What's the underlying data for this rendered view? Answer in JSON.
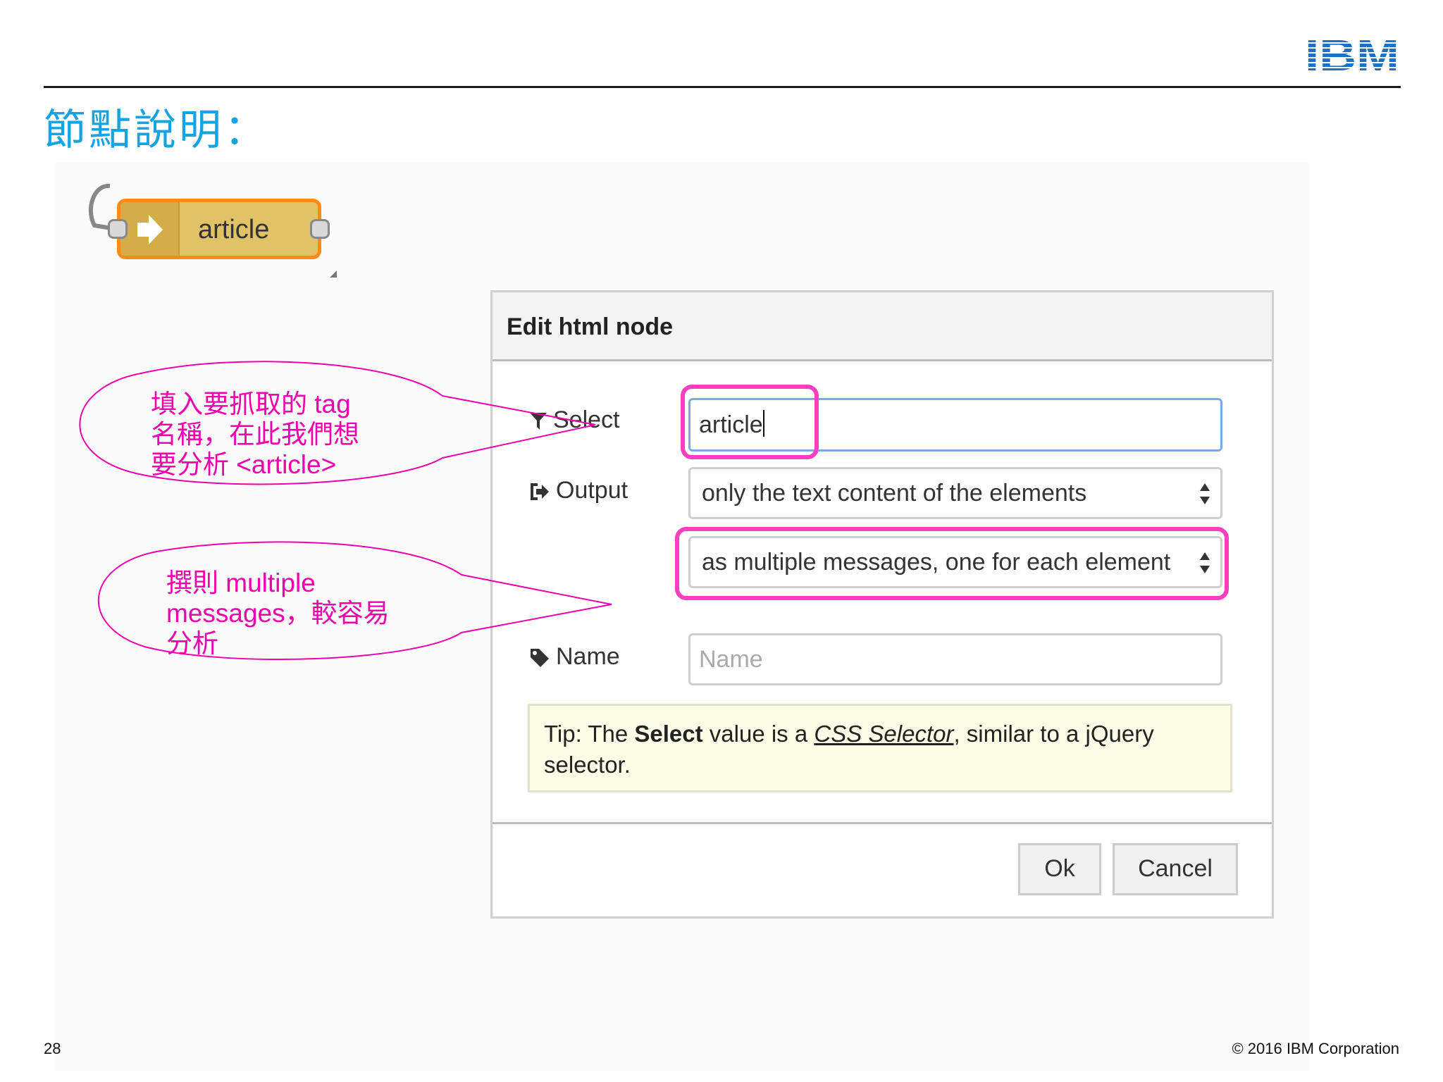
{
  "header": {
    "logo_text": "IBM",
    "title": "節點說明："
  },
  "flow_node": {
    "label": "article"
  },
  "dialog": {
    "title": "Edit html node",
    "select": {
      "label": "Select",
      "value": "article"
    },
    "output": {
      "label": "Output",
      "selected_option": "only the text content of the elements",
      "mode_option": "as multiple messages, one for each element"
    },
    "name": {
      "label": "Name",
      "placeholder": "Name",
      "value": ""
    },
    "tip": {
      "prefix": "Tip: The ",
      "bold": "Select",
      "middle": " value is a ",
      "link": "CSS Selector",
      "suffix": ", similar to a jQuery selector."
    },
    "buttons": {
      "ok": "Ok",
      "cancel": "Cancel"
    }
  },
  "callouts": {
    "select_note": [
      "填入要抓取的  tag",
      "名稱，在此我們想",
      "要分析 <article>"
    ],
    "output_note": [
      "撰則 multiple",
      "messages，較容易",
      "分析"
    ]
  },
  "footer": {
    "page_number": "28",
    "copyright": "© 2016 IBM Corporation"
  },
  "colors": {
    "title": "#15a3e2",
    "highlight": "#ff3fbf",
    "callout": "#ee00ae",
    "node_border": "#ff8a18",
    "node_fill": "#e2c266"
  }
}
